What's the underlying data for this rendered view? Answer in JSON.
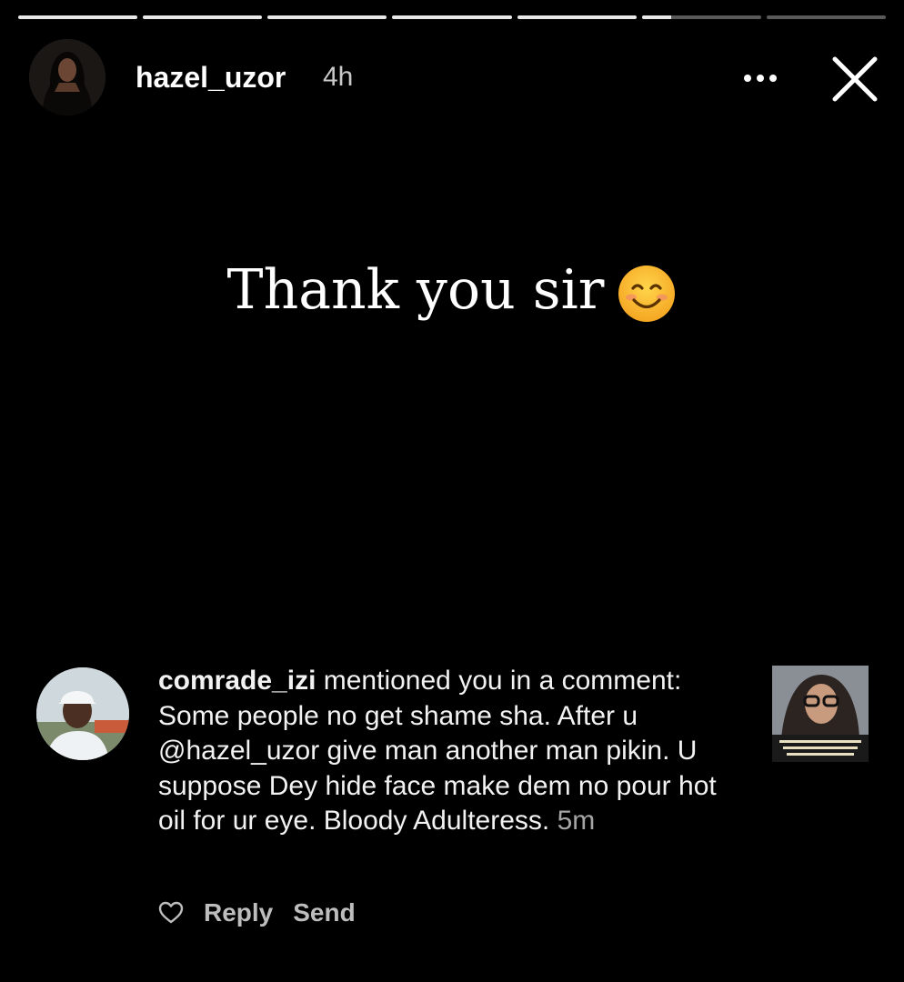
{
  "story": {
    "progress": [
      1,
      1,
      1,
      1,
      1,
      0.25,
      0
    ],
    "username": "hazel_uzor",
    "time": "4h",
    "caption": "Thank you sir"
  },
  "notification": {
    "username": "comrade_izi",
    "message": " mentioned you in a comment: Some people no get shame sha. After u @hazel_uzor give man another man pikin. U suppose Dey hide face make dem no pour hot oil for ur eye. Bloody Adulteress.",
    "time": "5m",
    "reply_label": "Reply",
    "send_label": "Send"
  },
  "icons": {
    "more": "more-horizontal-icon",
    "close": "close-icon",
    "like": "heart-icon",
    "emoji": "smiling-face-emoji"
  },
  "colors": {
    "background": "#000000",
    "text": "#ffffff",
    "muted": "#a5a5a5"
  }
}
